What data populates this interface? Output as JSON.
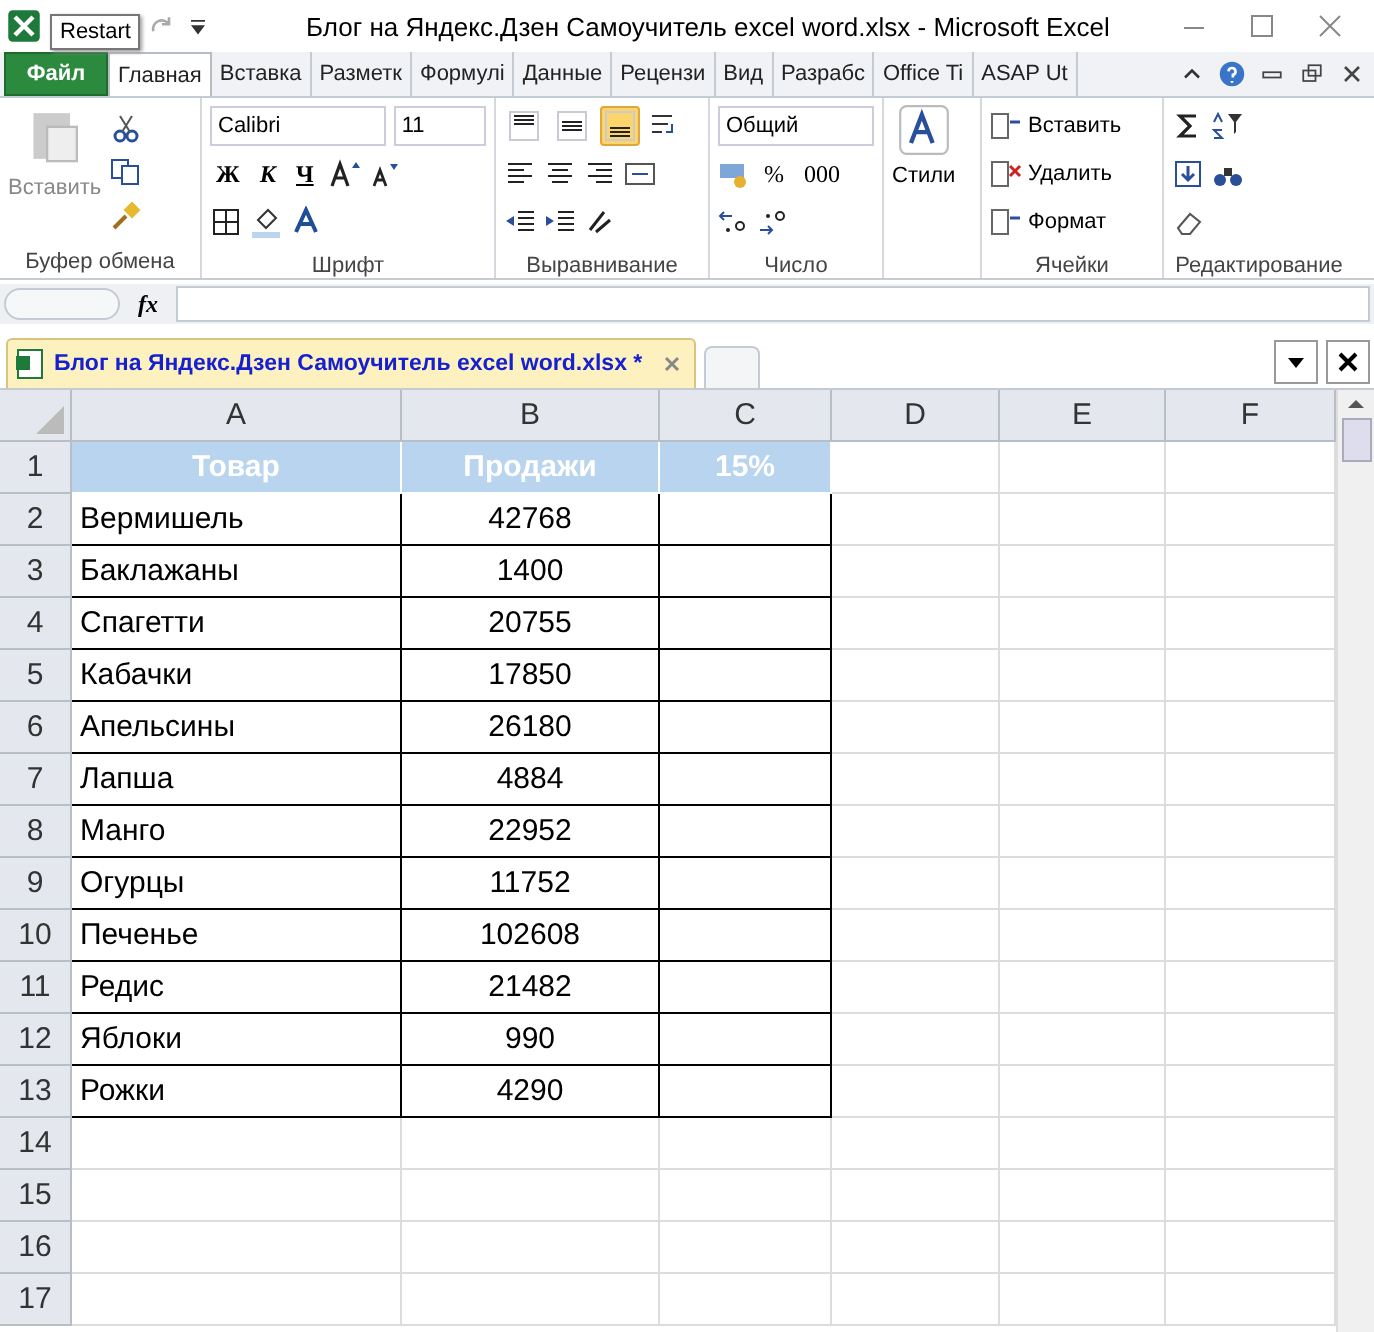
{
  "window": {
    "title": "Блог на Яндекс.Дзен Самоучитель excel word.xlsx  -  Microsoft Excel",
    "tooltip": "Restart"
  },
  "ribbon_tabs": [
    {
      "label": "Файл",
      "kind": "file",
      "selected": false
    },
    {
      "label": "Главная",
      "kind": "tab",
      "selected": true
    },
    {
      "label": "Вставка",
      "kind": "tab",
      "selected": false
    },
    {
      "label": "Разметк",
      "kind": "tab",
      "selected": false
    },
    {
      "label": "Формулі",
      "kind": "tab",
      "selected": false
    },
    {
      "label": "Данные",
      "kind": "tab",
      "selected": false
    },
    {
      "label": "Рецензи",
      "kind": "tab",
      "selected": false
    },
    {
      "label": "Вид",
      "kind": "tab",
      "selected": false
    },
    {
      "label": "Разрабс",
      "kind": "tab",
      "selected": false
    },
    {
      "label": "Office Ti",
      "kind": "tab",
      "selected": false
    },
    {
      "label": "ASAP Ut",
      "kind": "tab",
      "selected": false
    }
  ],
  "clipboard": {
    "paste": "Вставить",
    "label": "Буфер обмена"
  },
  "font": {
    "name": "Calibri",
    "size": "11",
    "bold": "Ж",
    "italic": "К",
    "underline": "Ч",
    "label": "Шрифт"
  },
  "alignment": {
    "vertical": [
      {
        "selected": false
      },
      {
        "selected": false
      },
      {
        "selected": true
      }
    ],
    "label": "Выравнивание"
  },
  "number": {
    "format": "Общий",
    "percent": "%",
    "thousands": "000",
    "label": "Число"
  },
  "styles": {
    "label": "Стили"
  },
  "cells": {
    "items": [
      "Вставить",
      "Удалить",
      "Формат"
    ],
    "label": "Ячейки"
  },
  "editing": {
    "label": "Редактирование"
  },
  "formula_bar": {
    "fx": "fx"
  },
  "document_tab": {
    "title": "Блог на Яндекс.Дзен Самоучитель excel word.xlsx *"
  },
  "sheet": {
    "columns": [
      "A",
      "B",
      "C",
      "D",
      "E",
      "F"
    ],
    "rows": [
      {
        "number": "1",
        "kind": "header",
        "cells": [
          "Товар",
          "Продажи",
          "15%"
        ]
      },
      {
        "number": "2",
        "kind": "data",
        "cells": [
          "Вермишель",
          "42768"
        ]
      },
      {
        "number": "3",
        "kind": "data",
        "cells": [
          "Баклажаны",
          "1400"
        ]
      },
      {
        "number": "4",
        "kind": "data",
        "cells": [
          "Спагетти",
          "20755"
        ]
      },
      {
        "number": "5",
        "kind": "data",
        "cells": [
          "Кабачки",
          "17850"
        ]
      },
      {
        "number": "6",
        "kind": "data",
        "cells": [
          "Апельсины",
          "26180"
        ]
      },
      {
        "number": "7",
        "kind": "data",
        "cells": [
          "Лапша",
          "4884"
        ]
      },
      {
        "number": "8",
        "kind": "data",
        "cells": [
          "Манго",
          "22952"
        ]
      },
      {
        "number": "9",
        "kind": "data",
        "cells": [
          "Огурцы",
          "11752"
        ]
      },
      {
        "number": "10",
        "kind": "data",
        "cells": [
          "Печенье",
          "102608"
        ]
      },
      {
        "number": "11",
        "kind": "data",
        "cells": [
          "Редис",
          "21482"
        ]
      },
      {
        "number": "12",
        "kind": "data",
        "cells": [
          "Яблоки",
          "990"
        ]
      },
      {
        "number": "13",
        "kind": "data",
        "cells": [
          "Рожки",
          "4290"
        ]
      },
      {
        "number": "14",
        "kind": "blank",
        "cells": []
      },
      {
        "number": "15",
        "kind": "blank",
        "cells": []
      },
      {
        "number": "16",
        "kind": "blank",
        "cells": []
      },
      {
        "number": "17",
        "kind": "blank",
        "cells": []
      }
    ]
  }
}
